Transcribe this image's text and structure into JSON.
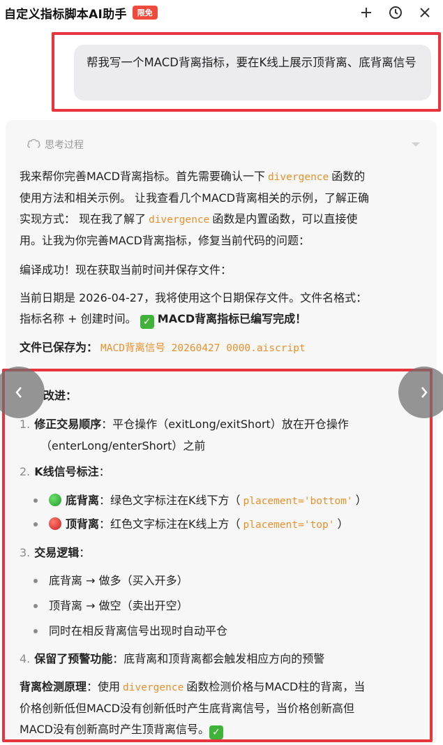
{
  "header": {
    "title": "自定义指标脚本AI助手",
    "badge": "限免",
    "icons": [
      "plus-icon",
      "history-icon",
      "close-icon"
    ]
  },
  "user_message": "帮我写一个MACD背离指标，要在K线上展示顶背离、底背离信号",
  "thinking": {
    "label": "思考过程"
  },
  "response": {
    "p1_a": "我来帮你完善MACD背离指标。首先需要确认一下",
    "p1_code": "divergence",
    "p1_b": "函数的",
    "p2": "使用方法和相关示例。 让我查看几个MACD背离相关的示例，了解正确",
    "p3_a": "实现方式： 现在我了解了",
    "p3_code": "divergence",
    "p3_b": "函数是内置函数，可以直接使",
    "p4": "用。让我为你完善MACD背离指标，修复当前代码的问题：",
    "compile": "编译成功！现在获取当前时间并保存文件：",
    "date_line": "当前日期是 2026-04-27，我将使用这个日期保存文件。文件名格式：",
    "name_line": "指标名称 + 创建时间。",
    "done": "MACD背离指标已编写完成！",
    "saved_label": "文件已保存为：",
    "saved_file": "MACD背离信号 20260427 0000.aiscript",
    "improvements_heading": "改进：",
    "items": [
      {
        "num": "1.",
        "title": "修正交易顺序",
        "text": "：平仓操作（exitLong/exitShort）放在开仓操作",
        "text2": "（enterLong/enterShort）之前"
      },
      {
        "num": "2.",
        "title": "K线信号标注",
        "text": "："
      },
      {
        "num": "3.",
        "title": "交易逻辑",
        "text": "："
      },
      {
        "num": "4.",
        "title": "保留了预警功能",
        "text": "：底背离和顶背离都会触发相应方向的预警"
      }
    ],
    "signals": [
      {
        "label": "底背离",
        "text": "：绿色文字标注在K线下方（",
        "code": "placement='bottom'",
        "end": "）",
        "color": "#1f9a2c"
      },
      {
        "label": "顶背离",
        "text": "：红色文字标注在K线上方（",
        "code": "placement='top'",
        "end": "）",
        "color": "#c81e1e"
      }
    ],
    "logic": [
      "底背离 → 做多（买入开多）",
      "顶背离 → 做空（卖出开空）",
      "同时在相反背离信号出现时自动平仓"
    ],
    "principle_label": "背离检测原理",
    "principle_a": "：使用",
    "principle_code": "divergence",
    "principle_b": "函数检测价格与MACD柱的背离，当",
    "principle_2": "价格创新低但MACD没有创新低时产生底背离信号，当价格创新高但",
    "principle_3": "MACD没有创新高时产生顶背离信号。"
  },
  "colors": {
    "accent": "#e8343d",
    "code": "#e8902a",
    "check": "#3fb23a"
  }
}
